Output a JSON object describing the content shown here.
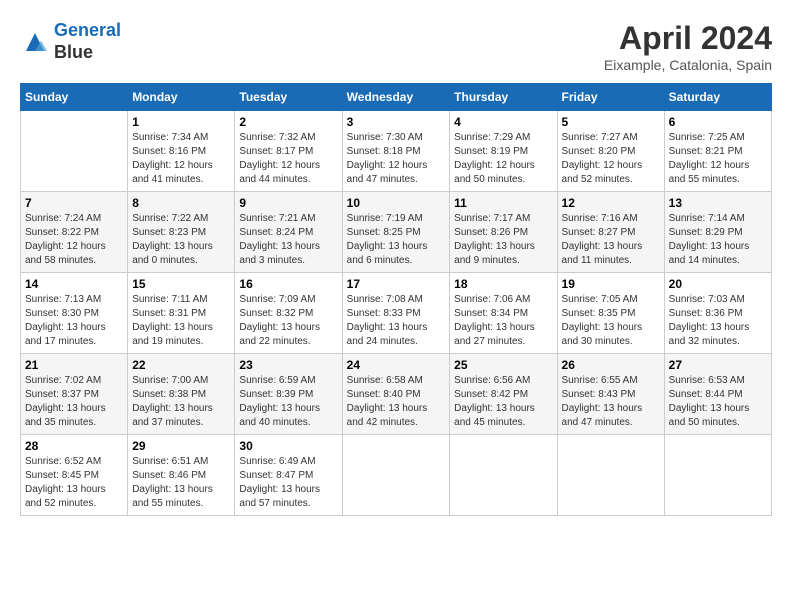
{
  "header": {
    "logo_line1": "General",
    "logo_line2": "Blue",
    "month_title": "April 2024",
    "location": "Eixample, Catalonia, Spain"
  },
  "weekdays": [
    "Sunday",
    "Monday",
    "Tuesday",
    "Wednesday",
    "Thursday",
    "Friday",
    "Saturday"
  ],
  "weeks": [
    [
      {
        "day": "",
        "sunrise": "",
        "sunset": "",
        "daylight": ""
      },
      {
        "day": "1",
        "sunrise": "Sunrise: 7:34 AM",
        "sunset": "Sunset: 8:16 PM",
        "daylight": "Daylight: 12 hours and 41 minutes."
      },
      {
        "day": "2",
        "sunrise": "Sunrise: 7:32 AM",
        "sunset": "Sunset: 8:17 PM",
        "daylight": "Daylight: 12 hours and 44 minutes."
      },
      {
        "day": "3",
        "sunrise": "Sunrise: 7:30 AM",
        "sunset": "Sunset: 8:18 PM",
        "daylight": "Daylight: 12 hours and 47 minutes."
      },
      {
        "day": "4",
        "sunrise": "Sunrise: 7:29 AM",
        "sunset": "Sunset: 8:19 PM",
        "daylight": "Daylight: 12 hours and 50 minutes."
      },
      {
        "day": "5",
        "sunrise": "Sunrise: 7:27 AM",
        "sunset": "Sunset: 8:20 PM",
        "daylight": "Daylight: 12 hours and 52 minutes."
      },
      {
        "day": "6",
        "sunrise": "Sunrise: 7:25 AM",
        "sunset": "Sunset: 8:21 PM",
        "daylight": "Daylight: 12 hours and 55 minutes."
      }
    ],
    [
      {
        "day": "7",
        "sunrise": "Sunrise: 7:24 AM",
        "sunset": "Sunset: 8:22 PM",
        "daylight": "Daylight: 12 hours and 58 minutes."
      },
      {
        "day": "8",
        "sunrise": "Sunrise: 7:22 AM",
        "sunset": "Sunset: 8:23 PM",
        "daylight": "Daylight: 13 hours and 0 minutes."
      },
      {
        "day": "9",
        "sunrise": "Sunrise: 7:21 AM",
        "sunset": "Sunset: 8:24 PM",
        "daylight": "Daylight: 13 hours and 3 minutes."
      },
      {
        "day": "10",
        "sunrise": "Sunrise: 7:19 AM",
        "sunset": "Sunset: 8:25 PM",
        "daylight": "Daylight: 13 hours and 6 minutes."
      },
      {
        "day": "11",
        "sunrise": "Sunrise: 7:17 AM",
        "sunset": "Sunset: 8:26 PM",
        "daylight": "Daylight: 13 hours and 9 minutes."
      },
      {
        "day": "12",
        "sunrise": "Sunrise: 7:16 AM",
        "sunset": "Sunset: 8:27 PM",
        "daylight": "Daylight: 13 hours and 11 minutes."
      },
      {
        "day": "13",
        "sunrise": "Sunrise: 7:14 AM",
        "sunset": "Sunset: 8:29 PM",
        "daylight": "Daylight: 13 hours and 14 minutes."
      }
    ],
    [
      {
        "day": "14",
        "sunrise": "Sunrise: 7:13 AM",
        "sunset": "Sunset: 8:30 PM",
        "daylight": "Daylight: 13 hours and 17 minutes."
      },
      {
        "day": "15",
        "sunrise": "Sunrise: 7:11 AM",
        "sunset": "Sunset: 8:31 PM",
        "daylight": "Daylight: 13 hours and 19 minutes."
      },
      {
        "day": "16",
        "sunrise": "Sunrise: 7:09 AM",
        "sunset": "Sunset: 8:32 PM",
        "daylight": "Daylight: 13 hours and 22 minutes."
      },
      {
        "day": "17",
        "sunrise": "Sunrise: 7:08 AM",
        "sunset": "Sunset: 8:33 PM",
        "daylight": "Daylight: 13 hours and 24 minutes."
      },
      {
        "day": "18",
        "sunrise": "Sunrise: 7:06 AM",
        "sunset": "Sunset: 8:34 PM",
        "daylight": "Daylight: 13 hours and 27 minutes."
      },
      {
        "day": "19",
        "sunrise": "Sunrise: 7:05 AM",
        "sunset": "Sunset: 8:35 PM",
        "daylight": "Daylight: 13 hours and 30 minutes."
      },
      {
        "day": "20",
        "sunrise": "Sunrise: 7:03 AM",
        "sunset": "Sunset: 8:36 PM",
        "daylight": "Daylight: 13 hours and 32 minutes."
      }
    ],
    [
      {
        "day": "21",
        "sunrise": "Sunrise: 7:02 AM",
        "sunset": "Sunset: 8:37 PM",
        "daylight": "Daylight: 13 hours and 35 minutes."
      },
      {
        "day": "22",
        "sunrise": "Sunrise: 7:00 AM",
        "sunset": "Sunset: 8:38 PM",
        "daylight": "Daylight: 13 hours and 37 minutes."
      },
      {
        "day": "23",
        "sunrise": "Sunrise: 6:59 AM",
        "sunset": "Sunset: 8:39 PM",
        "daylight": "Daylight: 13 hours and 40 minutes."
      },
      {
        "day": "24",
        "sunrise": "Sunrise: 6:58 AM",
        "sunset": "Sunset: 8:40 PM",
        "daylight": "Daylight: 13 hours and 42 minutes."
      },
      {
        "day": "25",
        "sunrise": "Sunrise: 6:56 AM",
        "sunset": "Sunset: 8:42 PM",
        "daylight": "Daylight: 13 hours and 45 minutes."
      },
      {
        "day": "26",
        "sunrise": "Sunrise: 6:55 AM",
        "sunset": "Sunset: 8:43 PM",
        "daylight": "Daylight: 13 hours and 47 minutes."
      },
      {
        "day": "27",
        "sunrise": "Sunrise: 6:53 AM",
        "sunset": "Sunset: 8:44 PM",
        "daylight": "Daylight: 13 hours and 50 minutes."
      }
    ],
    [
      {
        "day": "28",
        "sunrise": "Sunrise: 6:52 AM",
        "sunset": "Sunset: 8:45 PM",
        "daylight": "Daylight: 13 hours and 52 minutes."
      },
      {
        "day": "29",
        "sunrise": "Sunrise: 6:51 AM",
        "sunset": "Sunset: 8:46 PM",
        "daylight": "Daylight: 13 hours and 55 minutes."
      },
      {
        "day": "30",
        "sunrise": "Sunrise: 6:49 AM",
        "sunset": "Sunset: 8:47 PM",
        "daylight": "Daylight: 13 hours and 57 minutes."
      },
      {
        "day": "",
        "sunrise": "",
        "sunset": "",
        "daylight": ""
      },
      {
        "day": "",
        "sunrise": "",
        "sunset": "",
        "daylight": ""
      },
      {
        "day": "",
        "sunrise": "",
        "sunset": "",
        "daylight": ""
      },
      {
        "day": "",
        "sunrise": "",
        "sunset": "",
        "daylight": ""
      }
    ]
  ]
}
